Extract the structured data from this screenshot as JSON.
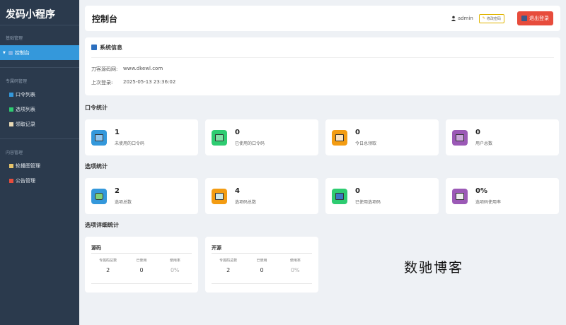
{
  "app": {
    "title": "发码小程序"
  },
  "sidebar": {
    "groups": [
      {
        "title": "基础管理",
        "items": [
          {
            "label": "控制台",
            "active": true
          }
        ]
      },
      {
        "title": "专属码管理",
        "items": [
          {
            "label": "口令列表"
          },
          {
            "label": "选项列表"
          },
          {
            "label": "领取记录"
          }
        ]
      },
      {
        "title": "内容管理",
        "items": [
          {
            "label": "轮播图管理"
          },
          {
            "label": "公告管理"
          }
        ]
      }
    ]
  },
  "header": {
    "title": "控制台",
    "user": "admin",
    "change_password": "修改密码",
    "logout": "退出登录"
  },
  "system_info": {
    "title": "系统信息",
    "rows": [
      {
        "key": "刀客源码网:",
        "value": "www.dkewl.com"
      },
      {
        "key": "上次登录:",
        "value": "2025-05-13 23:36:02"
      }
    ]
  },
  "sections": {
    "code_stats": "口令统计",
    "option_stats": "选项统计",
    "option_detail": "选项详细统计"
  },
  "code_stats": [
    {
      "value": "1",
      "label": "未使用的口令码",
      "color": "#3498db",
      "icon": "qr-icon"
    },
    {
      "value": "0",
      "label": "已使用的口令码",
      "color": "#2ecc71",
      "icon": "check-icon"
    },
    {
      "value": "0",
      "label": "今日总领取",
      "color": "#f39c12",
      "icon": "calendar-icon"
    },
    {
      "value": "0",
      "label": "用户总数",
      "color": "#9b59b6",
      "icon": "users-icon"
    }
  ],
  "option_stats": [
    {
      "value": "2",
      "label": "选项总数",
      "color": "#3498db",
      "icon": "puzzle-icon"
    },
    {
      "value": "4",
      "label": "选项码总数",
      "color": "#f39c12",
      "icon": "keyboard-icon"
    },
    {
      "value": "0",
      "label": "已使用选项码",
      "color": "#2ecc71",
      "icon": "record-icon"
    },
    {
      "value": "0%",
      "label": "选项码使用率",
      "color": "#9b59b6",
      "icon": "bar-chart-icon"
    }
  ],
  "option_details": [
    {
      "name": "源码",
      "headers": [
        "专属码总数",
        "已使用",
        "使用率"
      ],
      "values": [
        "2",
        "0",
        "0%"
      ]
    },
    {
      "name": "开源",
      "headers": [
        "专属码总数",
        "已使用",
        "使用率"
      ],
      "values": [
        "2",
        "0",
        "0%"
      ]
    }
  ],
  "watermark": "数驰博客"
}
